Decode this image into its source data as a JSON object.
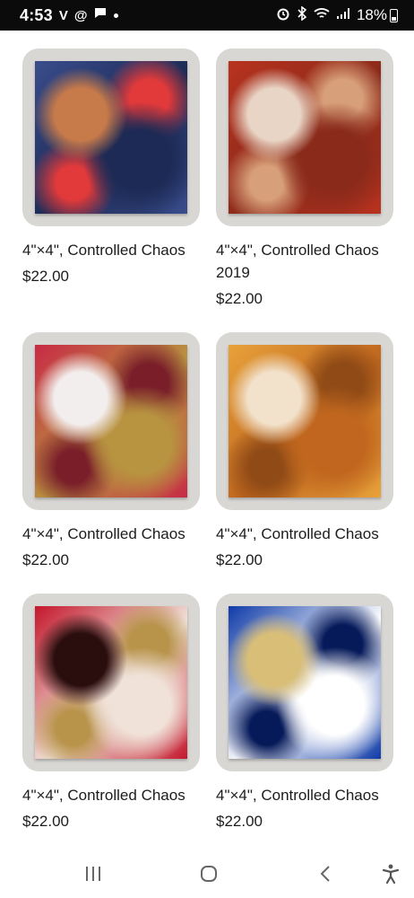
{
  "status_bar": {
    "time": "4:53",
    "left_icons": [
      "v-icon",
      "threads-icon",
      "messages-icon",
      "dot-icon"
    ],
    "right_icons": [
      "alarm-icon",
      "bluetooth-icon",
      "wifi-icon",
      "signal-icon"
    ],
    "battery": "18%"
  },
  "products": [
    {
      "title": "4\"×4\", Controlled Chaos",
      "price": "$22.00",
      "colors": [
        "#3a4d8c",
        "#c77a4a",
        "#1c2a55",
        "#e23a3a"
      ]
    },
    {
      "title": "4\"×4\", Controlled Chaos 2019",
      "price": "$22.00",
      "colors": [
        "#b8321f",
        "#e9d5c5",
        "#8a2a1a",
        "#d8a07a"
      ]
    },
    {
      "title": "4\"×4\", Controlled Chaos",
      "price": "$22.00",
      "colors": [
        "#c82a45",
        "#f3eeee",
        "#b89440",
        "#7a1f2a"
      ]
    },
    {
      "title": "4\"×4\", Controlled Chaos",
      "price": "$22.00",
      "colors": [
        "#e8a23a",
        "#f2e2cc",
        "#c0661e",
        "#8f4a16"
      ]
    },
    {
      "title": "4\"×4\", Controlled Chaos",
      "price": "$22.00",
      "colors": [
        "#c4172c",
        "#2a0e0e",
        "#f0e2d8",
        "#b8934a"
      ]
    },
    {
      "title": "4\"×4\", Controlled Chaos",
      "price": "$22.00",
      "colors": [
        "#0f3ba8",
        "#d9be78",
        "#ffffff",
        "#061a5a"
      ]
    }
  ],
  "nav_bar": {
    "icons": [
      "recent-apps-icon",
      "home-icon",
      "back-icon",
      "accessibility-icon"
    ]
  }
}
